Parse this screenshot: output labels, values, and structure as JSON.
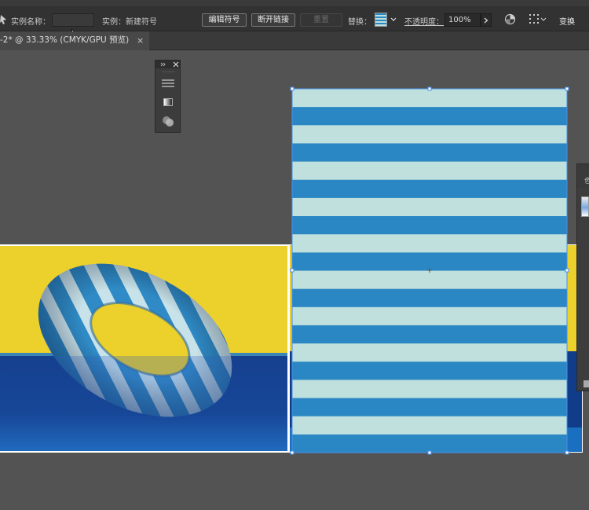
{
  "control_bar": {
    "instance_name_label": "实例名称：",
    "instance_name_value": "",
    "instance_of_label": "实例：新建符号",
    "edit_symbol_label": "编辑符号",
    "break_link_label": "断开链接",
    "reset_label": "重置",
    "replace_label": "替换：",
    "opacity_label": "不透明度：",
    "opacity_value": "100%",
    "transform_label": "变换"
  },
  "tab": {
    "title": "-2* @ 33.33% (CMYK/GPU 预览)",
    "close_glyph": "×"
  },
  "colors": {
    "stripe_light": "#bfe0dd",
    "stripe_dark": "#2b87c3",
    "yellow": "#ecd02b",
    "navy": "#0e3a84",
    "selection": "#4a8fe8"
  },
  "icons": [
    "selection-tool-icon",
    "cursor-icon",
    "symbol-swatch-icon",
    "dropdown-arrow-icon",
    "chevron-right-icon",
    "recolor-icon",
    "align-grid-icon",
    "panel-menu-icon",
    "gradient-icon",
    "appearance-icon",
    "collapse-icon",
    "panel-close-icon"
  ]
}
